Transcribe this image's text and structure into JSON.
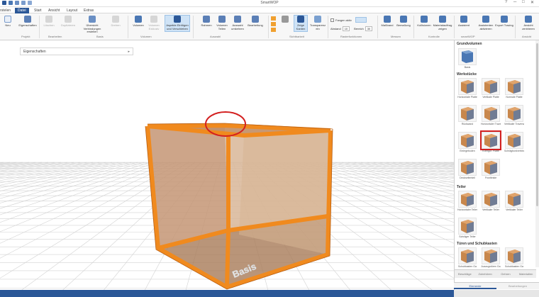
{
  "app_title": "SmartWOP",
  "left_label": "rstelen",
  "tabs": [
    {
      "label": "Datei",
      "active": true
    },
    {
      "label": "Start"
    },
    {
      "label": "Ansicht"
    },
    {
      "label": "Layout"
    },
    {
      "label": "Extras"
    }
  ],
  "ribbon": {
    "buttons": [
      {
        "label": "Neu"
      },
      {
        "label": "Eigenschaften"
      },
      {
        "label": "Löschen",
        "disabled": true
      },
      {
        "label": "Duplizieren",
        "disabled": true
      },
      {
        "label": "Übersicht Verbindungen erstellen"
      },
      {
        "label": "Drehen",
        "disabled": true
      },
      {
        "label": "Volumen"
      },
      {
        "label": "Volumen Exklusiv",
        "disabled": true
      },
      {
        "label": "Aspekte Einfügen und Verschieben",
        "highlight": true
      },
      {
        "label": "Rahmen"
      },
      {
        "label": "Volumen Teilen"
      },
      {
        "label": "Auswahl umkehren"
      },
      {
        "label": "Bearbeitung"
      },
      {
        "label": "Zeige Kanten",
        "highlight": true
      },
      {
        "label": "Transparenz ein"
      },
      {
        "label": "Maßband"
      },
      {
        "label": "Bemaßung"
      },
      {
        "label": "Kollisionen"
      },
      {
        "label": "Materialauftrag zeigen"
      },
      {
        "label": "Assistent"
      },
      {
        "label": "Assistenten aktivieren"
      },
      {
        "label": "Export Tracing"
      },
      {
        "label": "Ansicht zentrieren"
      }
    ],
    "groups": [
      "Projekt",
      "Bearbeiten",
      "Basis",
      "Volumen",
      "Auswahl",
      "Sichtbarkeit",
      "Rasterfunktionen",
      "Messen",
      "Kontrolle",
      "smartWOP",
      "Ansicht"
    ],
    "fangen_label": "Fangen aktiv",
    "abstand_label": "Abstand",
    "abstand_value": "10",
    "bereich_label": "Bereich",
    "bereich_value": "30"
  },
  "properties_panel": {
    "title": "Eigenschaften",
    "pin": "▸"
  },
  "scene": {
    "label": "Basis"
  },
  "right_panel": {
    "sections": [
      {
        "title": "Grundvolumen",
        "items": [
          "Basis"
        ]
      },
      {
        "title": "Werkstücke",
        "items": [
          "Horizontale Platte",
          "Vertikale Platte",
          "Normale Platte",
          "Rückwand",
          "Horizontaler Traverse",
          "Vertikaler Traverse",
          "Einlegeboden",
          "Konfigur. Platte",
          "Schrägbordverbinder",
          "Deckseitenteil",
          "Frontleiste"
        ]
      },
      {
        "title": "Teiler",
        "items": [
          "Horizontaler Teiler",
          "Vertikaler Teiler",
          "Vertikaler Teiler",
          "Schräger Teiler"
        ]
      },
      {
        "title": "Türen und Schubkasten",
        "items": [
          "Schubkasten Ga",
          "Auszugstüren Ga",
          "Schubkasten Ga"
        ]
      }
    ],
    "tabs": [
      "Beschläge",
      "Zubehören",
      "Gehren",
      "Materialien"
    ]
  },
  "bottom_tabs": [
    {
      "label": "Elemente",
      "active": true
    },
    {
      "label": "Bearbeitungen"
    }
  ],
  "colors": {
    "accent": "#2b5797",
    "box_edge": "#f08a1e",
    "box_fill": "#c98f5e",
    "selection": "#d32020"
  }
}
